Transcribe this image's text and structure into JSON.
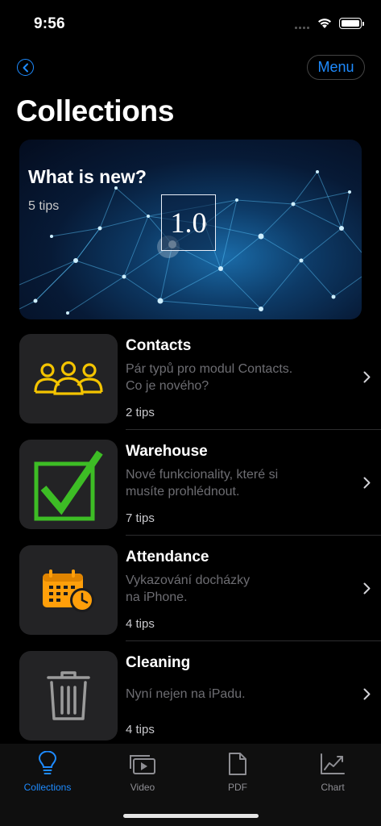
{
  "status_bar": {
    "time": "9:56"
  },
  "nav": {
    "back_icon": "chevron-left-circle-icon",
    "menu_label": "Menu"
  },
  "page_title": "Collections",
  "hero": {
    "title": "What is new?",
    "subtitle": "5 tips",
    "version": "1.0"
  },
  "items": [
    {
      "title": "Contacts",
      "desc_line1": "Pár typů pro modul Contacts.",
      "desc_line2": "Co je nového?",
      "count": "2 tips",
      "icon": "people-group-icon",
      "icon_color": "#f4c400"
    },
    {
      "title": "Warehouse",
      "desc_line1": "Nové funkcionality, které si",
      "desc_line2": "musíte prohlédnout.",
      "count": "7 tips",
      "icon": "checkbox-checked-icon",
      "icon_color": "#3dbd25"
    },
    {
      "title": "Attendance",
      "desc_line1": "Vykazování docházky",
      "desc_line2": "na iPhone.",
      "count": "4 tips",
      "icon": "calendar-clock-icon",
      "icon_color": "#ff9f0a"
    },
    {
      "title": "Cleaning",
      "desc_line1": "Nyní nejen na iPadu.",
      "desc_line2": "",
      "count": "4 tips",
      "icon": "trash-icon",
      "icon_color": "#9b9b9b"
    }
  ],
  "tabs": [
    {
      "label": "Collections",
      "icon": "lightbulb-icon",
      "active": true
    },
    {
      "label": "Video",
      "icon": "video-stack-icon",
      "active": false
    },
    {
      "label": "PDF",
      "icon": "document-icon",
      "active": false
    },
    {
      "label": "Chart",
      "icon": "line-chart-icon",
      "active": false
    }
  ],
  "colors": {
    "accent": "#1e8bff",
    "background": "#000000",
    "card": "#232325"
  }
}
